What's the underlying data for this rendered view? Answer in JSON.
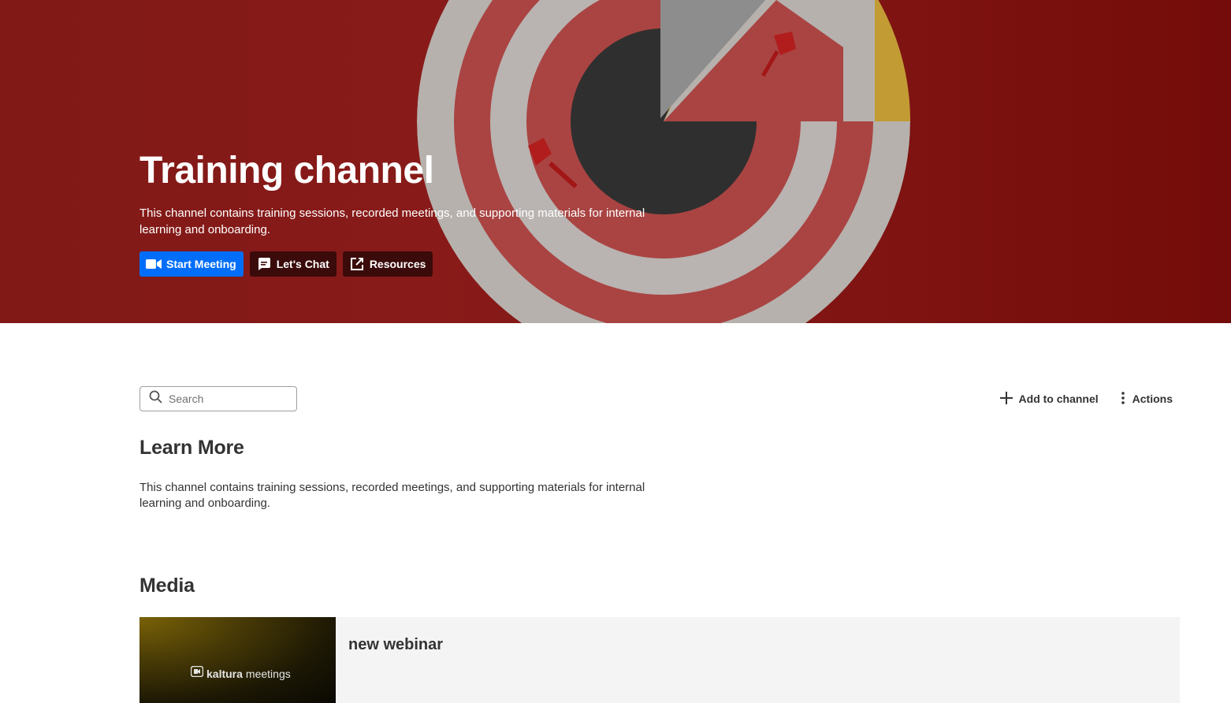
{
  "hero": {
    "title": "Training channel",
    "description": "This channel contains training sessions, recorded meetings, and supporting materials for internal learning and onboarding.",
    "buttons": [
      {
        "label": "Start Meeting",
        "icon": "video-camera-icon"
      },
      {
        "label": "Let's Chat",
        "icon": "chat-bubble-icon"
      },
      {
        "label": "Resources",
        "icon": "external-link-icon"
      }
    ],
    "background_image": "dartboard-with-darts",
    "colors": {
      "hero_red": "#8c1c1a",
      "primary_button": "#006efa",
      "dark_button": "#3a0b0a"
    }
  },
  "toolbar": {
    "search_placeholder": "Search",
    "add_label": "Add to channel",
    "actions_label": "Actions"
  },
  "learn_more": {
    "title": "Learn More",
    "description": "This channel contains training sessions, recorded meetings, and supporting materials for internal learning and onboarding."
  },
  "media": {
    "title": "Media",
    "items": [
      {
        "name": "new webinar",
        "thumbnail_brand_1": "kaltura",
        "thumbnail_brand_2": "meetings"
      }
    ]
  }
}
